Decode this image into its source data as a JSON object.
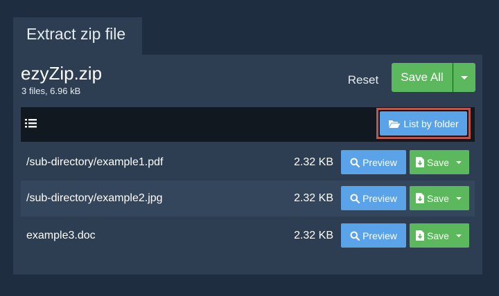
{
  "tab": {
    "label": "Extract zip file"
  },
  "archive": {
    "name": "ezyZip.zip",
    "info": "3 files, 6.96 kB"
  },
  "actions": {
    "reset_label": "Reset",
    "save_all_label": "Save All"
  },
  "toolbar": {
    "list_by_folder_label": "List by folder"
  },
  "files": [
    {
      "path": "/sub-directory/example1.pdf",
      "size": "2.32 KB",
      "preview_label": "Preview",
      "save_label": "Save"
    },
    {
      "path": "/sub-directory/example2.jpg",
      "size": "2.32 KB",
      "preview_label": "Preview",
      "save_label": "Save"
    },
    {
      "path": "example3.doc",
      "size": "2.32 KB",
      "preview_label": "Preview",
      "save_label": "Save"
    }
  ],
  "icons": {
    "list": "list-icon",
    "folder": "folder-open-icon",
    "search": "search-icon",
    "file_download": "file-download-icon",
    "caret": "caret-down-icon"
  },
  "colors": {
    "background": "#1e2d40",
    "panel": "#2d3e52",
    "toolbar": "#111820",
    "row_alt": "#34465b",
    "primary": "#5aa3e8",
    "success": "#5cb85c",
    "highlight": "#c0554c"
  }
}
